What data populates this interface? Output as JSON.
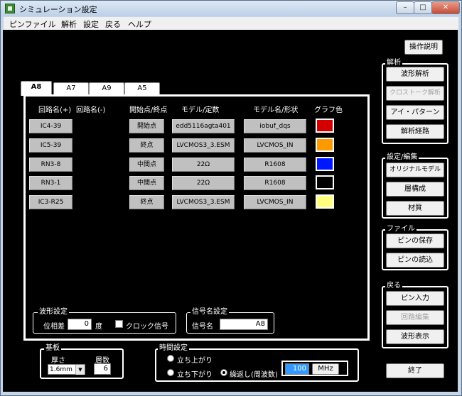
{
  "window": {
    "title": "シミュレーション設定",
    "min_glyph": "–",
    "max_glyph": "□",
    "close_glyph": "✕"
  },
  "menu": [
    "ピンファイル",
    "解析",
    "設定",
    "戻る",
    "ヘルプ"
  ],
  "help_button": "操作説明",
  "tabs": [
    "A8",
    "A7",
    "A9",
    "A5"
  ],
  "columns": {
    "net_plus": "回路名(+)",
    "net_minus": "回路名(-)",
    "endpoint": "開始点/終点",
    "model": "モデル/定数",
    "model_shape": "モデル名/形状",
    "graph_color": "グラフ色"
  },
  "rows": [
    {
      "net": "IC4-39",
      "endpoint": "開始点",
      "model": "edd5116agta401",
      "model_name": "iobuf_dqs",
      "color": "#d40000"
    },
    {
      "net": "IC5-39",
      "endpoint": "終点",
      "model": "LVCMOS3_3.ESM",
      "model_name": "LVCMOS_IN",
      "color": "#ff9900"
    },
    {
      "net": "RN3-8",
      "endpoint": "中間点",
      "model": "22Ω",
      "model_name": "R1608",
      "color": "#0018ff"
    },
    {
      "net": "RN3-1",
      "endpoint": "中間点",
      "model": "22Ω",
      "model_name": "R1608",
      "color": "#000000"
    },
    {
      "net": "IC3-R25",
      "endpoint": "終点",
      "model": "LVCMOS3_3.ESM",
      "model_name": "LVCMOS_IN",
      "color": "#ffff80"
    }
  ],
  "waveform_settings": {
    "title": "波形設定",
    "phase_label": "位相差",
    "phase_value": "0",
    "degree_unit": "度",
    "clock_label": "クロック信号"
  },
  "signal_name": {
    "title": "信号名設定",
    "label": "信号名",
    "value": "A8"
  },
  "board": {
    "title": "基板",
    "thickness_label": "厚さ",
    "thickness_value": "1.6mm",
    "layers_label": "層数",
    "layers_value": "6"
  },
  "timing": {
    "title": "時間設定",
    "rise": "立ち上がり",
    "fall": "立ち下がり",
    "repeat": "繰返し(周波数)",
    "freq_value": "100",
    "freq_unit": "MHz"
  },
  "analysis": {
    "title": "解析",
    "buttons": [
      "波形解析",
      "クロストーク解析",
      "アイ・パターン",
      "解析経路"
    ]
  },
  "settings_edit": {
    "title": "設定/編集",
    "buttons": [
      "オリジナルモデル",
      "層構成",
      "材質"
    ]
  },
  "file": {
    "title": "ファイル",
    "buttons": [
      "ピンの保存",
      "ピンの読込"
    ]
  },
  "back": {
    "title": "戻る",
    "buttons": [
      "ピン入力",
      "回路編集",
      "波形表示"
    ]
  },
  "exit_button": "終了"
}
